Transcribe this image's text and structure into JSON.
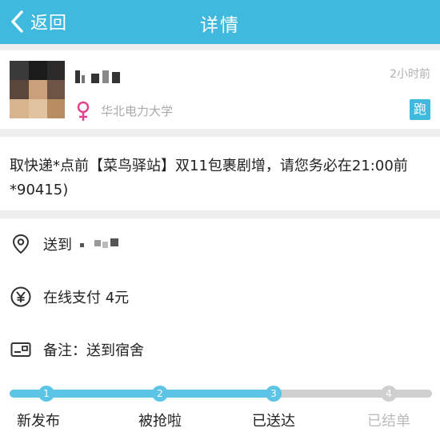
{
  "nav": {
    "back_label": "返回",
    "title": "详情",
    "color": "#3fb9dd"
  },
  "user": {
    "time": "2小时前",
    "school": "华北电力大学",
    "gender_icon": "female-icon",
    "badge": "跑"
  },
  "order": {
    "description": "取快递*点前【菜鸟驿站】双11包裹剧增，请您务必在21:00前*90415)"
  },
  "info": {
    "address_label": "送到",
    "payment": "在线支付 4元",
    "note": "备注：送到宿舍"
  },
  "progress": {
    "completed_steps": 3,
    "steps": [
      {
        "num": "1",
        "label": "新发布"
      },
      {
        "num": "2",
        "label": "被抢啦"
      },
      {
        "num": "3",
        "label": "已送达"
      },
      {
        "num": "4",
        "label": "已结单"
      }
    ],
    "accent": "#5cc4e4"
  }
}
